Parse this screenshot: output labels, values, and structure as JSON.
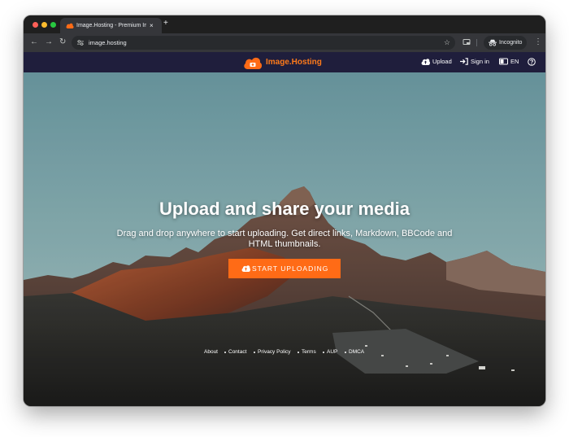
{
  "browser": {
    "tab_title": "Image.Hosting - Premium Ima",
    "tab_close": "×",
    "new_tab": "+",
    "back": "←",
    "forward": "→",
    "reload": "↻",
    "url": "image.hosting",
    "bookmark_star": "☆",
    "incognito_label": "Incognito",
    "menu": "⋮"
  },
  "site": {
    "brand": "Image.Hosting",
    "brand_color": "#ff7a1a",
    "nav": {
      "upload": "Upload",
      "sign_in": "Sign in",
      "language": "EN"
    },
    "hero": {
      "headline": "Upload and share your media",
      "subtitle": "Drag and drop anywhere to start uploading. Get direct links, Markdown, BBCode and HTML thumbnails.",
      "cta": "START UPLOADING"
    },
    "footer_links": [
      "About",
      "Contact",
      "Privacy Policy",
      "Terms",
      "AUP",
      "DMCA"
    ]
  },
  "colors": {
    "accent": "#ff6b16",
    "navbar": "#1f1e3c",
    "sky_top": "#6b9ca6",
    "sky_bottom": "#a9c7c7"
  },
  "icons": [
    "incognito-icon",
    "cloud-upload-icon",
    "sign-in-icon",
    "language-icon",
    "help-icon",
    "star-icon",
    "cast-icon",
    "tune-icon"
  ]
}
